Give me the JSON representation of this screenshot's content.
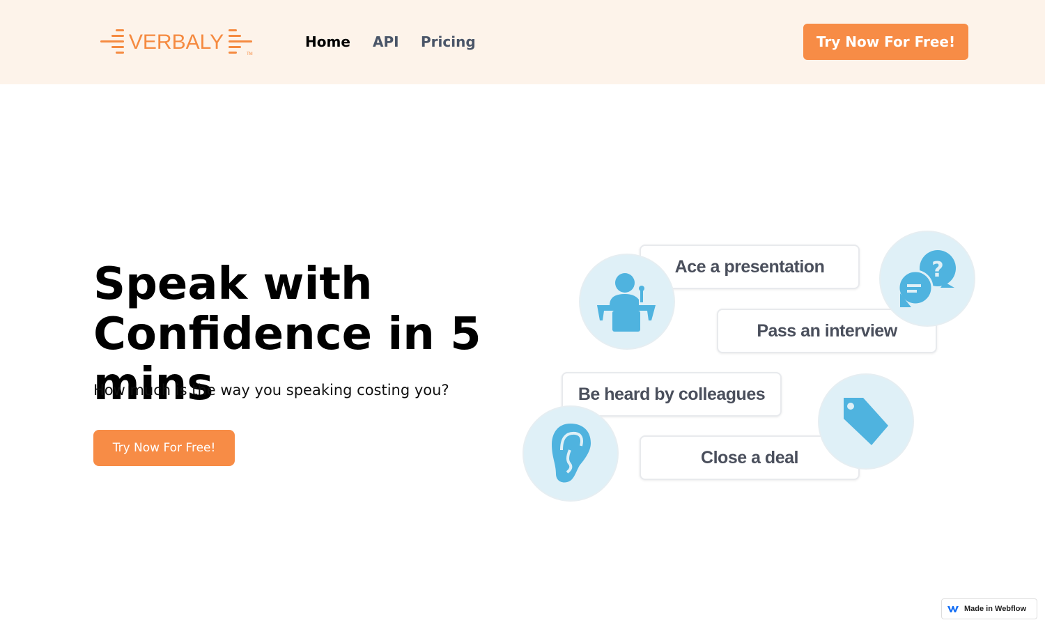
{
  "nav": {
    "logo": "VERBALY",
    "logo_tm": "TM",
    "links": [
      "Home",
      "API",
      "Pricing"
    ],
    "cta": "Try Now For Free!"
  },
  "hero": {
    "title_line1": "Speak with",
    "title_line2": "Confidence in 5 mins",
    "subtitle": "How much is the way you speaking costing you?",
    "cta": "Try Now For Free!"
  },
  "illustration": {
    "cards": [
      "Ace a presentation",
      "Pass an interview",
      "Be heard by colleagues",
      "Close a deal"
    ],
    "icons": [
      "presenter-icon",
      "chat-question-icon",
      "ear-icon",
      "tag-icon"
    ],
    "icon_color": "#4fb3df",
    "circle_color": "#dff0f7"
  },
  "badge": {
    "label": "Made in Webflow"
  },
  "colors": {
    "accent": "#f78c46",
    "nav_bg": "#fdf3ea"
  }
}
